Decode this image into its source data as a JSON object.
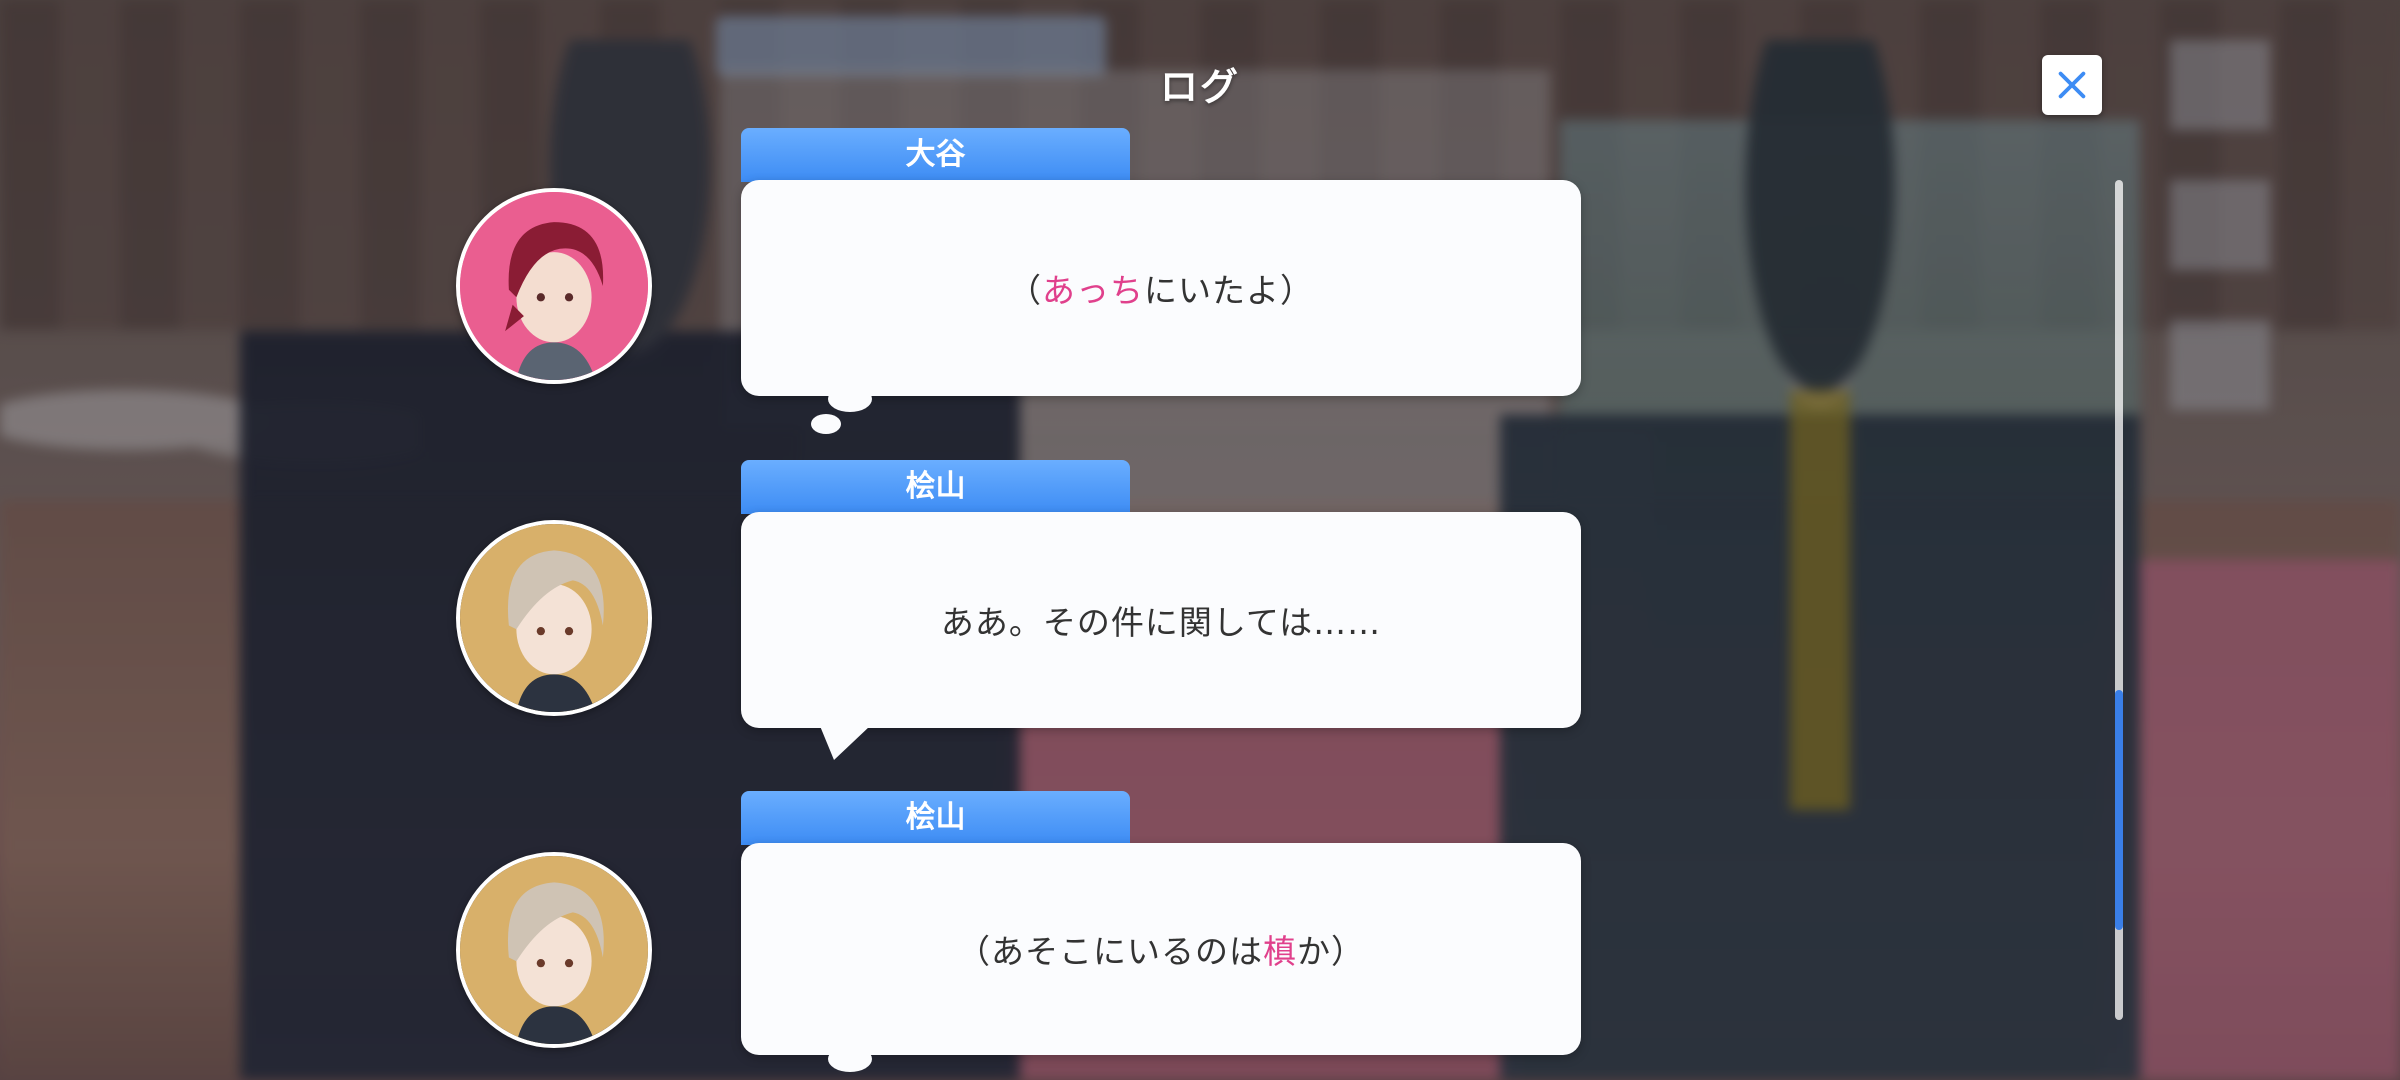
{
  "header": {
    "title": "ログ",
    "close_icon": "close-icon"
  },
  "colors": {
    "accent": "#3d8cf4",
    "highlight": "#e0408c",
    "bubble": "#fbfcfe"
  },
  "log": [
    {
      "name": "大谷",
      "text_before": "（",
      "text_highlight": "あっち",
      "text_after": "にいたよ）",
      "bubble_style": "thought",
      "avatar_icon": "character-avatar-otani"
    },
    {
      "name": "桧山",
      "text_before": "ああ。その件に関しては……",
      "text_highlight": "",
      "text_after": "",
      "bubble_style": "speech",
      "avatar_icon": "character-avatar-hiyama"
    },
    {
      "name": "桧山",
      "text_before": "（あそこにいるのは",
      "text_highlight": "槙",
      "text_after": "か）",
      "bubble_style": "thought",
      "avatar_icon": "character-avatar-hiyama"
    }
  ],
  "scrollbar": {
    "position_fraction": 0.68
  }
}
